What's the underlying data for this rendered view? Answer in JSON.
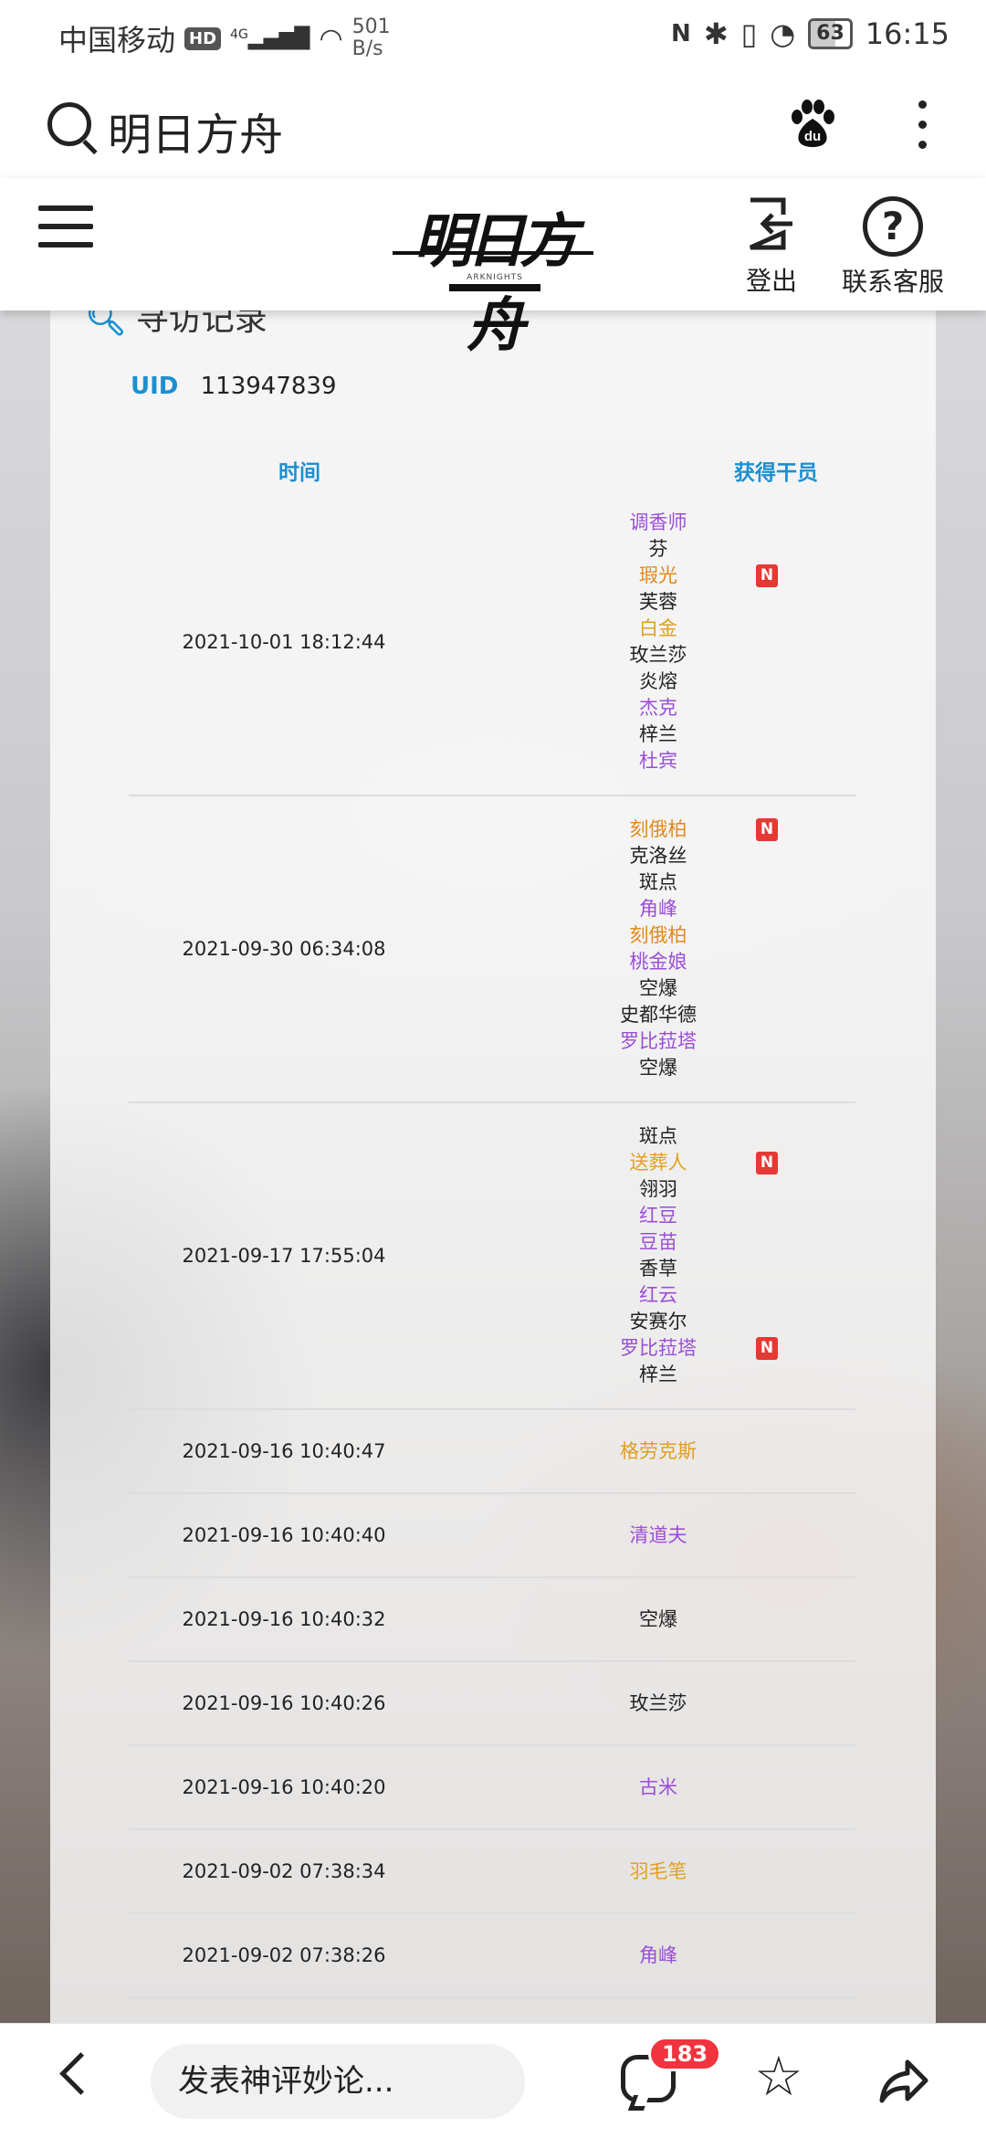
{
  "status_bar": {
    "carrier": "中国移动",
    "hd_badge": "HD",
    "network": "4G",
    "speed_value": "501",
    "speed_unit": "B/s",
    "battery": "63",
    "battery_fraction": 0.63,
    "time": "16:15"
  },
  "search_bar": {
    "query": "明日方舟",
    "icons": [
      "search-icon",
      "baidu-paw-icon",
      "more-vertical-icon"
    ]
  },
  "site_header": {
    "logo_text": "明日方舟",
    "logo_sub": "ARKNIGHTS",
    "logout_label": "登出",
    "help_label": "联系客服",
    "help_glyph": "?"
  },
  "card": {
    "title": "寻访记录",
    "uid_label": "UID",
    "uid_value": "113947839",
    "col_time": "时间",
    "col_operator": "获得干员"
  },
  "rarity_colors": {
    "c6": "#e08a1e",
    "c5": "#e0a020",
    "c4": "#9b4ed6",
    "c3": "#222222"
  },
  "records": [
    {
      "time": "2021-10-01 18:12:44",
      "ops": [
        {
          "name": "调香师",
          "r": "c4"
        },
        {
          "name": "芬",
          "r": "c3"
        },
        {
          "name": "瑕光",
          "r": "c6",
          "new": "N"
        },
        {
          "name": "芙蓉",
          "r": "c3"
        },
        {
          "name": "白金",
          "r": "c5"
        },
        {
          "name": "玫兰莎",
          "r": "c3"
        },
        {
          "name": "炎熔",
          "r": "c3"
        },
        {
          "name": "杰克",
          "r": "c4"
        },
        {
          "name": "梓兰",
          "r": "c3"
        },
        {
          "name": "杜宾",
          "r": "c4"
        }
      ]
    },
    {
      "time": "2021-09-30 06:34:08",
      "ops": [
        {
          "name": "刻俄柏",
          "r": "c6",
          "new": "N"
        },
        {
          "name": "克洛丝",
          "r": "c3"
        },
        {
          "name": "斑点",
          "r": "c3"
        },
        {
          "name": "角峰",
          "r": "c4"
        },
        {
          "name": "刻俄柏",
          "r": "c6"
        },
        {
          "name": "桃金娘",
          "r": "c4"
        },
        {
          "name": "空爆",
          "r": "c3"
        },
        {
          "name": "史都华德",
          "r": "c3"
        },
        {
          "name": "罗比菈塔",
          "r": "c4"
        },
        {
          "name": "空爆",
          "r": "c3"
        }
      ]
    },
    {
      "time": "2021-09-17 17:55:04",
      "ops": [
        {
          "name": "斑点",
          "r": "c3"
        },
        {
          "name": "送葬人",
          "r": "c5",
          "new": "N"
        },
        {
          "name": "翎羽",
          "r": "c3"
        },
        {
          "name": "红豆",
          "r": "c4"
        },
        {
          "name": "豆苗",
          "r": "c4"
        },
        {
          "name": "香草",
          "r": "c3"
        },
        {
          "name": "红云",
          "r": "c4"
        },
        {
          "name": "安赛尔",
          "r": "c3"
        },
        {
          "name": "罗比菈塔",
          "r": "c4",
          "new": "N"
        },
        {
          "name": "梓兰",
          "r": "c3"
        }
      ]
    },
    {
      "time": "2021-09-16 10:40:47",
      "ops": [
        {
          "name": "格劳克斯",
          "r": "c5"
        }
      ]
    },
    {
      "time": "2021-09-16 10:40:40",
      "ops": [
        {
          "name": "清道夫",
          "r": "c4"
        }
      ]
    },
    {
      "time": "2021-09-16 10:40:32",
      "ops": [
        {
          "name": "空爆",
          "r": "c3"
        }
      ]
    },
    {
      "time": "2021-09-16 10:40:26",
      "ops": [
        {
          "name": "玫兰莎",
          "r": "c3"
        }
      ]
    },
    {
      "time": "2021-09-16 10:40:20",
      "ops": [
        {
          "name": "古米",
          "r": "c4"
        }
      ]
    },
    {
      "time": "2021-09-02 07:38:34",
      "ops": [
        {
          "name": "羽毛笔",
          "r": "c5"
        }
      ]
    },
    {
      "time": "2021-09-02 07:38:26",
      "ops": [
        {
          "name": "角峰",
          "r": "c4"
        }
      ]
    }
  ],
  "bottom_bar": {
    "comment_placeholder": "发表神评妙论...",
    "comment_count": "183",
    "icons": [
      "back-icon",
      "comment-icon",
      "star-icon",
      "share-icon"
    ]
  }
}
